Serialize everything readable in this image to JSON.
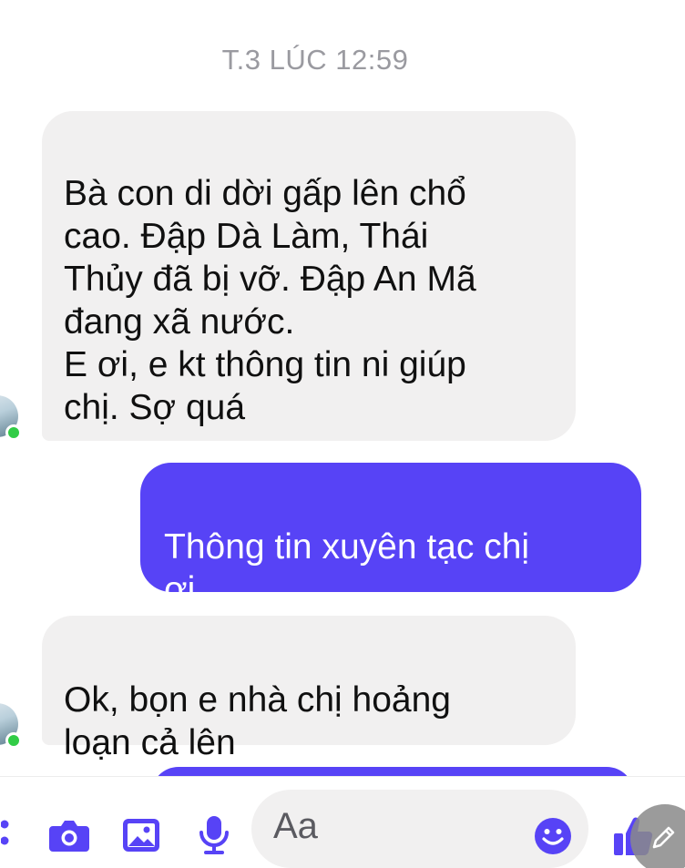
{
  "timestamp": "T.3 LÚC 12:59",
  "messages": [
    {
      "text": "Bà con di dời gấp lên chổ\ncao. Đập Dà Làm, Thái\nThủy đã bị vỡ. Đập An Mã\nđang xã nước.\nE ơi, e kt thông tin ni giúp\nchị. Sợ quá"
    },
    {
      "text": "Thông tin xuyên tạc chị\nơi"
    },
    {
      "text": "Ok, bọn e nhà chị hoảng\nloạn cả lên"
    }
  ],
  "composer": {
    "placeholder": "Aa",
    "icons": [
      "more-icon",
      "camera-icon",
      "image-icon",
      "microphone-icon",
      "emoji-icon",
      "like-icon",
      "edit-icon"
    ]
  },
  "colors": {
    "outgoing_bubble": "#5743f6",
    "incoming_bubble": "#f1f0f0",
    "accent": "#5743f6",
    "online": "#31cc46"
  }
}
